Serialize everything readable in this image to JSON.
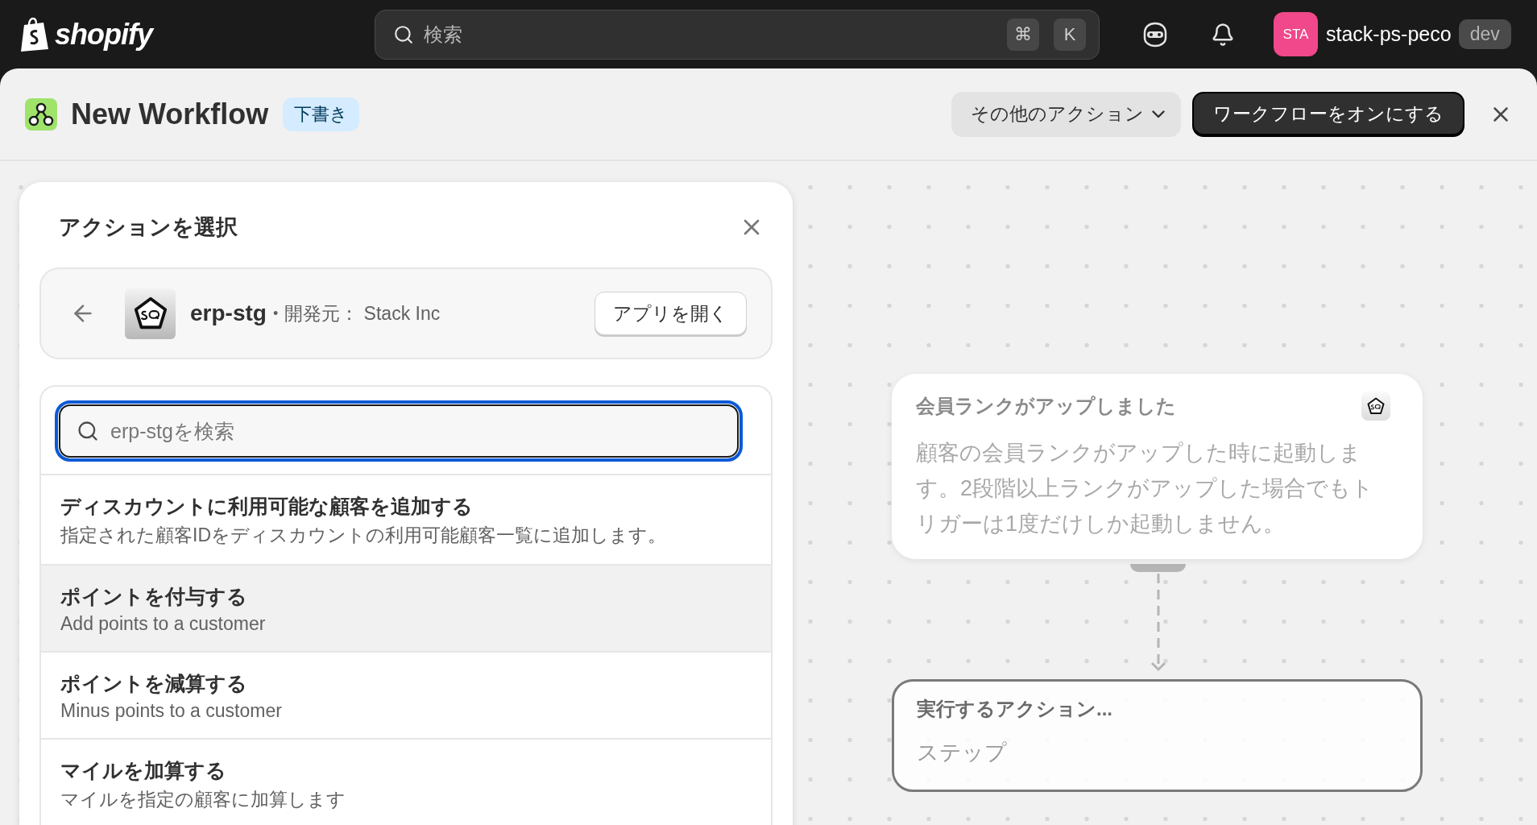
{
  "topbar": {
    "brand": "shopify",
    "search": {
      "placeholder": "検索"
    },
    "shortcut_keys": [
      "⌘",
      "K"
    ],
    "avatar": "STA",
    "store": "stack-ps-peco",
    "badge": "dev"
  },
  "header": {
    "title": "New Workflow",
    "status": "下書き",
    "more_actions": "その他のアクション",
    "primary": "ワークフローをオンにする"
  },
  "panel": {
    "title": "アクションを選択",
    "app": {
      "name": "erp-stg",
      "separator": "•",
      "developer": "開発元： Stack Inc",
      "open_button": "アプリを開く"
    },
    "search": {
      "placeholder": "erp-stgを検索"
    },
    "actions": [
      {
        "title": "ディスカウントに利用可能な顧客を追加する",
        "description": "指定された顧客IDをディスカウントの利用可能顧客一覧に追加します。",
        "selected": false
      },
      {
        "title": "ポイントを付与する",
        "description": "Add points to a customer",
        "selected": true
      },
      {
        "title": "ポイントを減算する",
        "description": "Minus points to a customer",
        "selected": false
      },
      {
        "title": "マイルを加算する",
        "description": "マイルを指定の顧客に加算します",
        "selected": false
      }
    ]
  },
  "canvas": {
    "trigger": {
      "title": "会員ランクがアップしました",
      "description": "顧客の会員ランクがアップした時に起動します。2段階以上ランクがアップした場合でもトリガーは1度だけしか起動しません。"
    },
    "action": {
      "title": "実行するアクション...",
      "subtitle": "ステップ"
    }
  }
}
